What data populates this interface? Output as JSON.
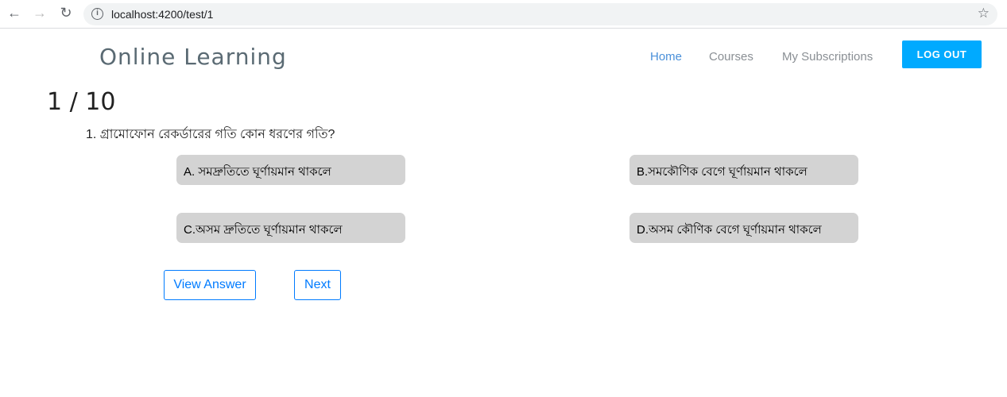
{
  "browser": {
    "url": "localhost:4200/test/1",
    "back_icon": "arrow-left",
    "forward_icon": "arrow-right",
    "reload_icon": "reload",
    "info_icon": "info",
    "star_icon": "star"
  },
  "header": {
    "brand": "Online Learning",
    "nav": [
      "Home",
      "Courses",
      "My Subscriptions"
    ],
    "logout": "LOG OUT",
    "accent": "#00aaff"
  },
  "quiz": {
    "progress": "1 / 10",
    "question": "1. গ্রামোফোন রেকর্ডারের গতি কোন ধরণের গতি?",
    "options": [
      "A. সমদ্রুতিতে ঘূর্ণায়মান থাকলে",
      "B.সমকৌণিক বেগে ঘূর্ণায়মান থাকলে",
      "C.অসম দ্রুতিতে ঘূর্ণায়মান থাকলে",
      "D.অসম কৌণিক বেগে ঘূর্ণায়মান থাকলে"
    ],
    "view_answer": "View Answer",
    "next": "Next"
  }
}
